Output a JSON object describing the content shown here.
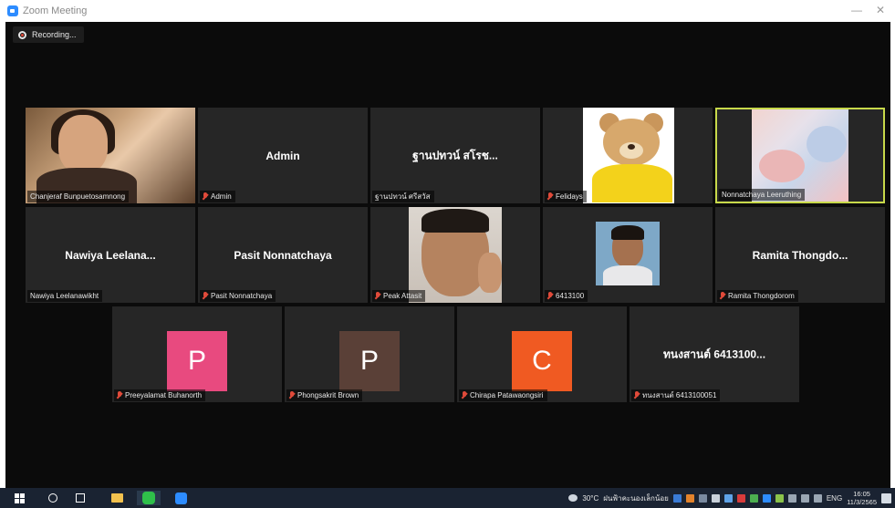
{
  "window": {
    "title": "Zoom Meeting",
    "minimize_glyph": "—",
    "close_glyph": "✕"
  },
  "recording": {
    "label": "Recording..."
  },
  "participants": [
    {
      "id": "p1",
      "display_name": "Chanjeraf Bunpuetosamnong",
      "center_name": "",
      "type": "video"
    },
    {
      "id": "p2",
      "display_name": "Admin",
      "center_name": "Admin",
      "type": "name",
      "muted": true
    },
    {
      "id": "p3",
      "display_name": "ฐานปทวน์ ศรีสวัส",
      "center_name": "ฐานปทวน์ สโรช...",
      "type": "name"
    },
    {
      "id": "p4",
      "display_name": "Felidays",
      "center_name": "",
      "type": "video",
      "muted": true
    },
    {
      "id": "p5",
      "display_name": "Nonnatchaya Leeruthing",
      "center_name": "",
      "type": "video",
      "active_speaker": true
    },
    {
      "id": "p6",
      "display_name": "Nawiya Leelanawikht",
      "center_name": "Nawiya Leelana...",
      "type": "name"
    },
    {
      "id": "p7",
      "display_name": "Pasit Nonnatchaya",
      "center_name": "Pasit Nonnatchaya",
      "type": "name",
      "muted": true
    },
    {
      "id": "p8",
      "display_name": "Peak Attasit",
      "center_name": "",
      "type": "video",
      "muted": true
    },
    {
      "id": "p9",
      "display_name": "6413100",
      "center_name": "",
      "type": "video",
      "muted": true
    },
    {
      "id": "p10",
      "display_name": "Ramita Thongdorom",
      "center_name": "Ramita Thongdo...",
      "type": "name",
      "muted": true
    },
    {
      "id": "p11",
      "display_name": "Preeyalamat Buhanorth",
      "center_name": "",
      "type": "avatar",
      "initial": "P",
      "color": "#e84a7f",
      "muted": true
    },
    {
      "id": "p12",
      "display_name": "Phongsakrit Brown",
      "center_name": "",
      "type": "avatar",
      "initial": "P",
      "color": "#5a4037",
      "muted": true
    },
    {
      "id": "p13",
      "display_name": "Chirapa Patawaongsiri",
      "center_name": "",
      "type": "avatar",
      "initial": "C",
      "color": "#f05a22",
      "muted": true
    },
    {
      "id": "p14",
      "display_name": "ทนงสานต์ 6413100051",
      "center_name": "ทนงสานต์ 6413100...",
      "type": "name",
      "muted": true
    }
  ],
  "taskbar": {
    "weather": "30°C",
    "weather_text": "ฝนฟ้าคะนองเล็กน้อย",
    "language": "ENG",
    "time": "16:05",
    "date": "11/3/2565"
  },
  "colors": {
    "meeting_bg": "#0b0b0b",
    "tile_bg": "#262626",
    "active_border": "#c8d94a",
    "muted_red": "#e04a3a",
    "taskbar_bg": "#1a2332"
  }
}
